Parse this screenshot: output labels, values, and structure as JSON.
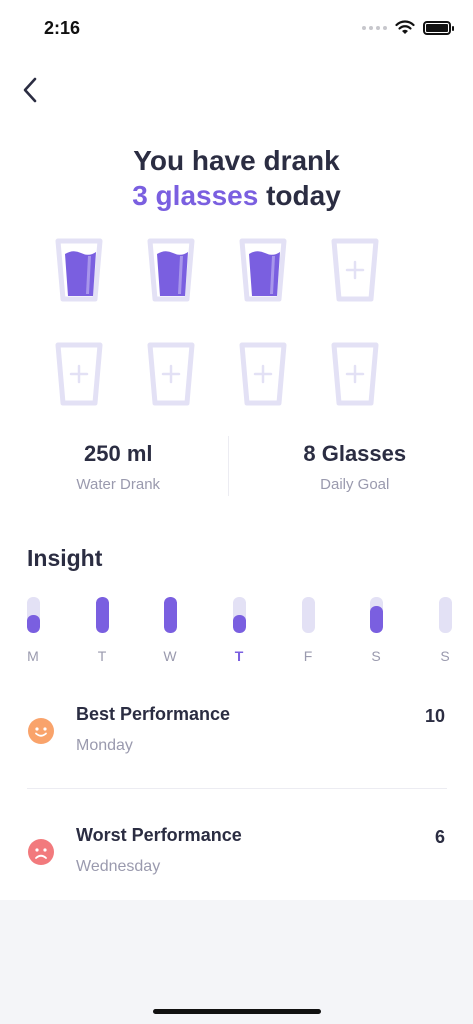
{
  "status_bar": {
    "time": "2:16"
  },
  "header": {
    "line1": "You have drank",
    "highlight": "3 glasses",
    "line2_rest": " today"
  },
  "glasses": {
    "total": 8,
    "filled": 3
  },
  "stats": {
    "drank_value": "250 ml",
    "drank_label": "Water Drank",
    "goal_value": "8 Glasses",
    "goal_label": "Daily Goal"
  },
  "insight": {
    "title": "Insight",
    "days": [
      {
        "label": "M",
        "level": 0.5,
        "active": false
      },
      {
        "label": "T",
        "level": 1.0,
        "active": false
      },
      {
        "label": "W",
        "level": 1.0,
        "active": false
      },
      {
        "label": "T",
        "level": 0.5,
        "active": true
      },
      {
        "label": "F",
        "level": 0.0,
        "active": false
      },
      {
        "label": "S",
        "level": 0.75,
        "active": false
      },
      {
        "label": "S",
        "level": 0.0,
        "active": false
      }
    ]
  },
  "best": {
    "title": "Best Performance",
    "day": "Monday",
    "value": "10"
  },
  "worst": {
    "title": "Worst Performance",
    "day": "Wednesday",
    "value": "6"
  },
  "colors": {
    "accent": "#7a5fe0",
    "track": "#e3e1f5",
    "best_face": "#f9a36b",
    "worst_face": "#f27a7d"
  }
}
